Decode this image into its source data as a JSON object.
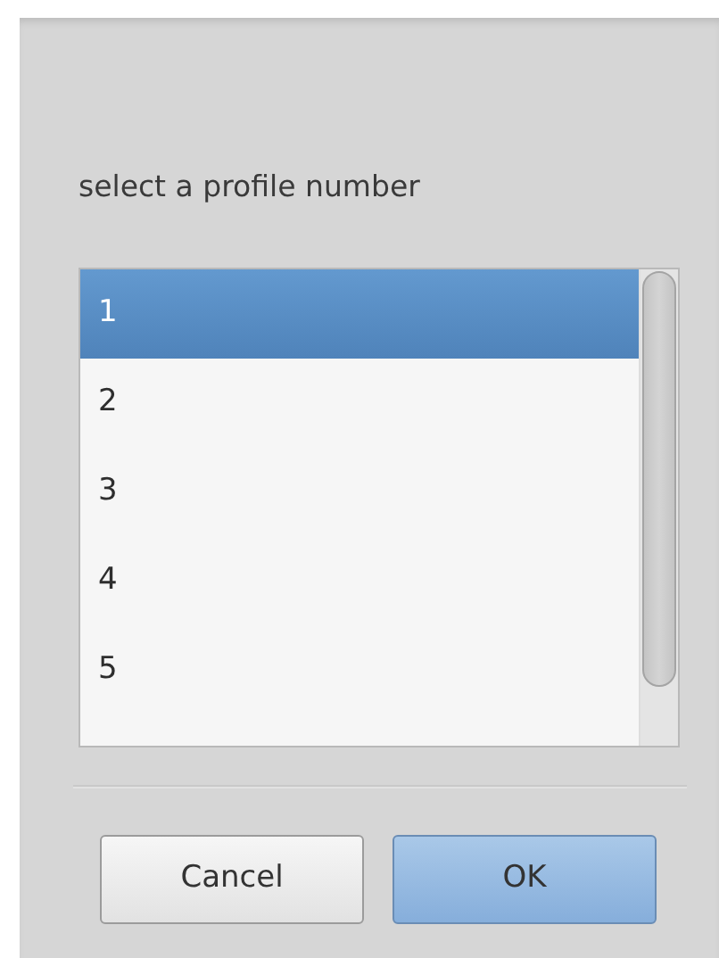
{
  "prompt": "select a profile number",
  "list": {
    "items": [
      {
        "label": "1",
        "selected": true
      },
      {
        "label": "2",
        "selected": false
      },
      {
        "label": "3",
        "selected": false
      },
      {
        "label": "4",
        "selected": false
      },
      {
        "label": "5",
        "selected": false
      }
    ]
  },
  "buttons": [
    {
      "label": "Cancel",
      "kind": "default"
    },
    {
      "label": "OK",
      "kind": "suggested"
    }
  ]
}
